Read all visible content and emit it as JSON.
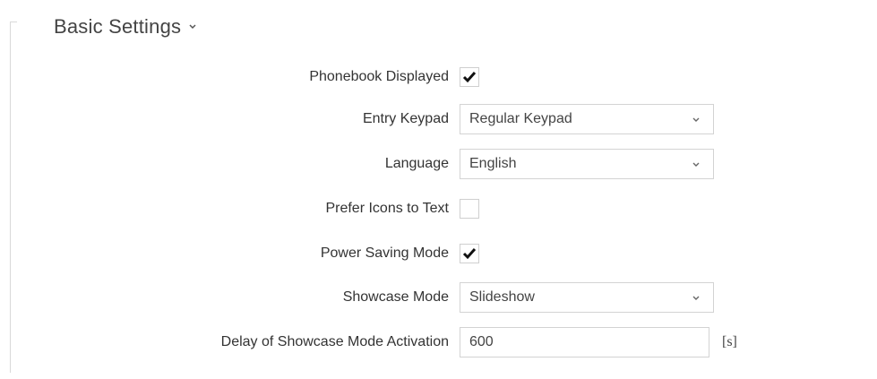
{
  "section": {
    "title": "Basic Settings",
    "collapse_icon": "chevron-down-icon"
  },
  "settings": {
    "phonebook_displayed": {
      "label": "Phonebook Displayed",
      "checked": true
    },
    "entry_keypad": {
      "label": "Entry Keypad",
      "value": "Regular Keypad"
    },
    "language": {
      "label": "Language",
      "value": "English"
    },
    "prefer_icons": {
      "label": "Prefer Icons to Text",
      "checked": false
    },
    "power_saving": {
      "label": "Power Saving Mode",
      "checked": true
    },
    "showcase_mode": {
      "label": "Showcase Mode",
      "value": "Slideshow"
    },
    "showcase_delay": {
      "label": "Delay of Showcase Mode Activation",
      "value": "600",
      "unit": "[s]"
    }
  },
  "icons": {
    "check": "checkmark-icon",
    "dropdown": "chevron-down-icon"
  },
  "colors": {
    "text": "#333333",
    "border": "#d3d3d3",
    "check": "#111111"
  }
}
